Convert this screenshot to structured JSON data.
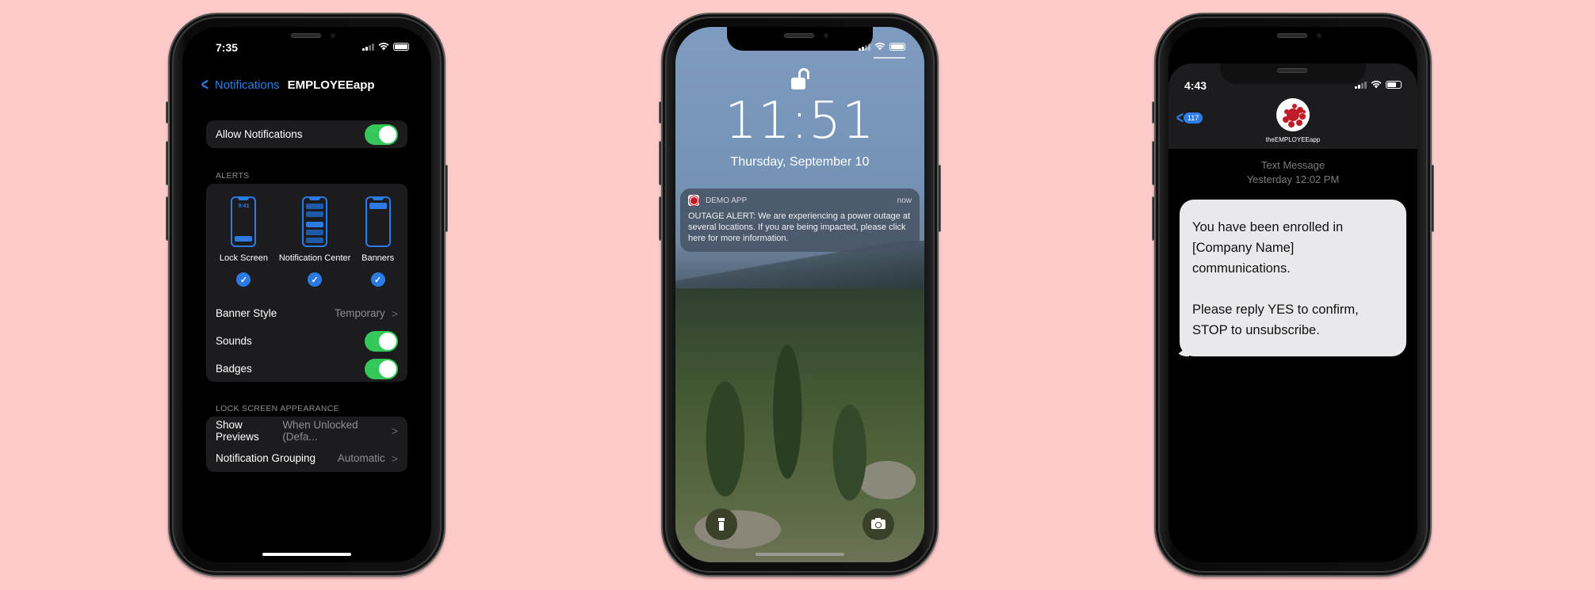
{
  "background_color": "#ffcaca",
  "phone_settings": {
    "status_time": "7:35",
    "nav_back_label": "Notifications",
    "nav_title": "EMPLOYEEapp",
    "allow_notifications": {
      "label": "Allow Notifications",
      "enabled": true
    },
    "alerts_header": "ALERTS",
    "alert_styles": [
      {
        "label": "Lock Screen",
        "preview_time": "9:41",
        "checked": true
      },
      {
        "label": "Notification Center",
        "checked": true
      },
      {
        "label": "Banners",
        "checked": true
      }
    ],
    "banner_style": {
      "label": "Banner Style",
      "value": "Temporary"
    },
    "sounds": {
      "label": "Sounds",
      "enabled": true
    },
    "badges": {
      "label": "Badges",
      "enabled": true
    },
    "lock_screen_header": "LOCK SCREEN APPEARANCE",
    "show_previews": {
      "label": "Show Previews",
      "value": "When Unlocked (Defa..."
    },
    "notification_grouping": {
      "label": "Notification Grouping",
      "value": "Automatic"
    },
    "accent_color": "#2f7ee6",
    "toggle_color": "#34c759"
  },
  "phone_lock": {
    "time": "11:51",
    "date": "Thursday, September 10",
    "notification": {
      "app_name": "DEMO APP",
      "timestamp": "now",
      "body": "OUTAGE ALERT: We are experiencing a power outage at several locations. If you are being impacted, please click here for more information."
    },
    "icons": [
      "unlock-icon",
      "flashlight-icon",
      "camera-icon"
    ]
  },
  "phone_messages": {
    "status_time": "4:43",
    "back_count": "117",
    "contact_name": "theEMPLOYEEapp",
    "meta_type": "Text Message",
    "meta_time": "Yesterday 12:02 PM",
    "message_paragraphs": [
      "You have been enrolled in [Company Name] communications.",
      "Please reply YES to confirm, STOP to unsubscribe."
    ]
  }
}
